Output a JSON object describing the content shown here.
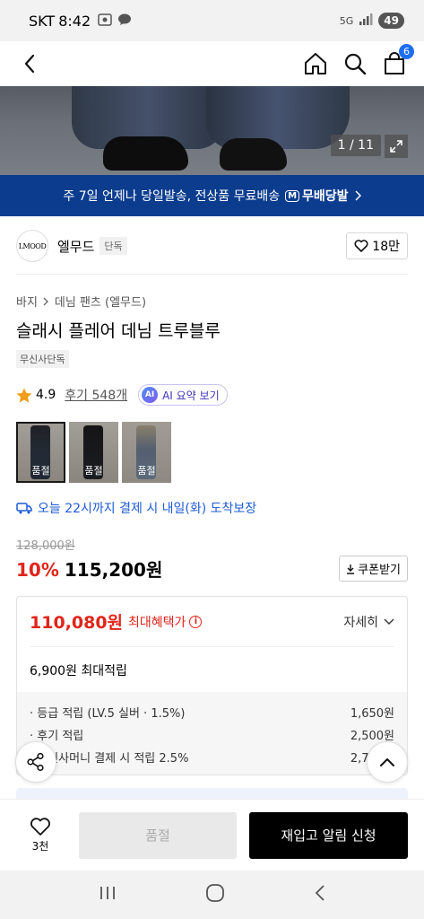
{
  "status_bar": {
    "carrier": "SKT",
    "time": "8:42",
    "network": "5G",
    "battery": "49"
  },
  "nav": {
    "cart_count": "6"
  },
  "gallery": {
    "counter": "1 / 11"
  },
  "promo": {
    "text": "주 7일 언제나 당일발송, 전상품 무료배송",
    "badge": "무배당발",
    "badge_mark": "M"
  },
  "brand": {
    "logo_text": "LMOOD",
    "name": "엘무드",
    "tag": "단독",
    "likes": "18만"
  },
  "breadcrumb": {
    "category": "바지",
    "subcategory": "데님 팬츠 (엘무드)"
  },
  "product": {
    "title": "슬래시 플레어 데님 트루블루",
    "exclusive_tag": "무신사단독",
    "rating": "4.9",
    "reviews": "후기 548개",
    "ai_badge": "AI",
    "ai_summary_label": "AI 요약 보기",
    "thumbnails": [
      {
        "label": "품절"
      },
      {
        "label": "품절"
      },
      {
        "label": "품절"
      }
    ],
    "delivery_text": "오늘 22시까지 결제 시 내일(화) 도착보장",
    "original_price": "128,000원",
    "discount": "10%",
    "price": "115,200원",
    "coupon_label": "쿠폰받기"
  },
  "benefit": {
    "max_price": "110,080원",
    "max_label": "최대혜택가",
    "detail_label": "자세히",
    "points_total": "6,900원 최대적립",
    "points": [
      {
        "label": "· 등급 적립 (LV.5 실버 · 1.5%)",
        "value": "1,650원"
      },
      {
        "label": "· 후기 적립",
        "value": "2,500원"
      },
      {
        "label": "· 무신사머니 결제 시 적립 2.5%",
        "value": "2,750원"
      }
    ]
  },
  "bottom_bar": {
    "like_count": "3천",
    "soldout_label": "품절",
    "restock_label": "재입고 알림 신청"
  },
  "colors": {
    "accent_red": "#e0251b",
    "banner_blue": "#0b3c8e",
    "link_blue": "#1d5bd6"
  }
}
